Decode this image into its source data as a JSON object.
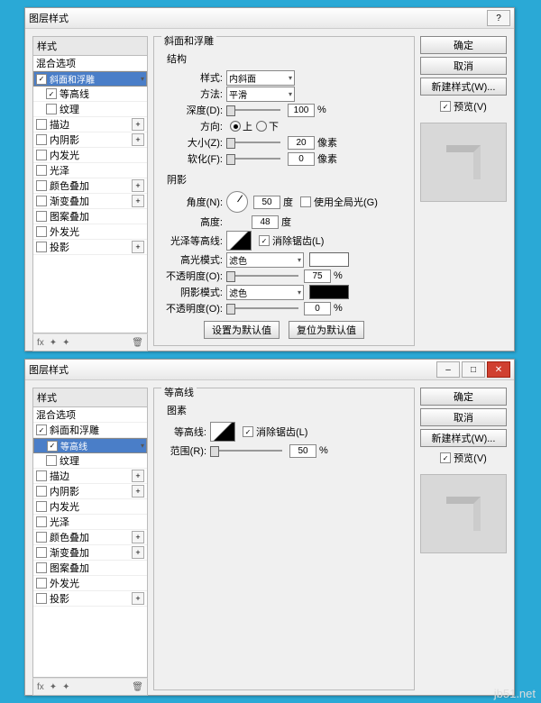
{
  "dialogs": [
    {
      "title": "图层样式",
      "blend_options": "混合选项",
      "styles_header": "样式",
      "styles": [
        {
          "label": "斜面和浮雕",
          "checked": true,
          "selected": true
        },
        {
          "label": "等高线",
          "checked": true,
          "sub": true
        },
        {
          "label": "纹理",
          "checked": false,
          "sub": true
        },
        {
          "label": "描边",
          "checked": false,
          "plus": true
        },
        {
          "label": "内阴影",
          "checked": false,
          "plus": true
        },
        {
          "label": "内发光",
          "checked": false
        },
        {
          "label": "光泽",
          "checked": false
        },
        {
          "label": "颜色叠加",
          "checked": false,
          "plus": true
        },
        {
          "label": "渐变叠加",
          "checked": false,
          "plus": true
        },
        {
          "label": "图案叠加",
          "checked": false
        },
        {
          "label": "外发光",
          "checked": false
        },
        {
          "label": "投影",
          "checked": false,
          "plus": true
        }
      ],
      "footer_fx": "fx",
      "panel": {
        "title": "斜面和浮雕",
        "section_structure": "结构",
        "style_label": "样式:",
        "style_value": "内斜面",
        "method_label": "方法:",
        "method_value": "平滑",
        "depth_label": "深度(D):",
        "depth_value": "100",
        "depth_unit": "%",
        "direction_label": "方向:",
        "dir_up": "上",
        "dir_down": "下",
        "size_label": "大小(Z):",
        "size_value": "20",
        "size_unit": "像素",
        "soften_label": "软化(F):",
        "soften_value": "0",
        "soften_unit": "像素",
        "section_shading": "阴影",
        "angle_label": "角度(N):",
        "angle_value": "50",
        "angle_unit": "度",
        "global_label": "使用全局光(G)",
        "altitude_label": "高度:",
        "altitude_value": "48",
        "altitude_unit": "度",
        "gloss_label": "光泽等高线:",
        "antialias_label": "消除锯齿(L)",
        "hlmode_label": "高光模式:",
        "hlmode_value": "滤色",
        "hlopacity_label": "不透明度(O):",
        "hlopacity_value": "75",
        "hlopacity_unit": "%",
        "shmode_label": "阴影模式:",
        "shmode_value": "滤色",
        "shopacity_label": "不透明度(O):",
        "shopacity_value": "0",
        "shopacity_unit": "%",
        "btn_default": "设置为默认值",
        "btn_reset": "复位为默认值"
      },
      "buttons": {
        "ok": "确定",
        "cancel": "取消",
        "new_style": "新建样式(W)...",
        "preview_label": "预览(V)"
      }
    },
    {
      "title": "图层样式",
      "blend_options": "混合选项",
      "styles_header": "样式",
      "styles": [
        {
          "label": "斜面和浮雕",
          "checked": true
        },
        {
          "label": "等高线",
          "checked": true,
          "sub": true,
          "selected": true
        },
        {
          "label": "纹理",
          "checked": false,
          "sub": true
        },
        {
          "label": "描边",
          "checked": false,
          "plus": true
        },
        {
          "label": "内阴影",
          "checked": false,
          "plus": true
        },
        {
          "label": "内发光",
          "checked": false
        },
        {
          "label": "光泽",
          "checked": false
        },
        {
          "label": "颜色叠加",
          "checked": false,
          "plus": true
        },
        {
          "label": "渐变叠加",
          "checked": false,
          "plus": true
        },
        {
          "label": "图案叠加",
          "checked": false
        },
        {
          "label": "外发光",
          "checked": false
        },
        {
          "label": "投影",
          "checked": false,
          "plus": true
        }
      ],
      "footer_fx": "fx",
      "panel": {
        "title": "等高线",
        "section": "图素",
        "contour_label": "等高线:",
        "antialias_label": "消除锯齿(L)",
        "range_label": "范围(R):",
        "range_value": "50",
        "range_unit": "%"
      },
      "buttons": {
        "ok": "确定",
        "cancel": "取消",
        "new_style": "新建样式(W)...",
        "preview_label": "预览(V)"
      }
    }
  ],
  "watermark": "jb51.net"
}
